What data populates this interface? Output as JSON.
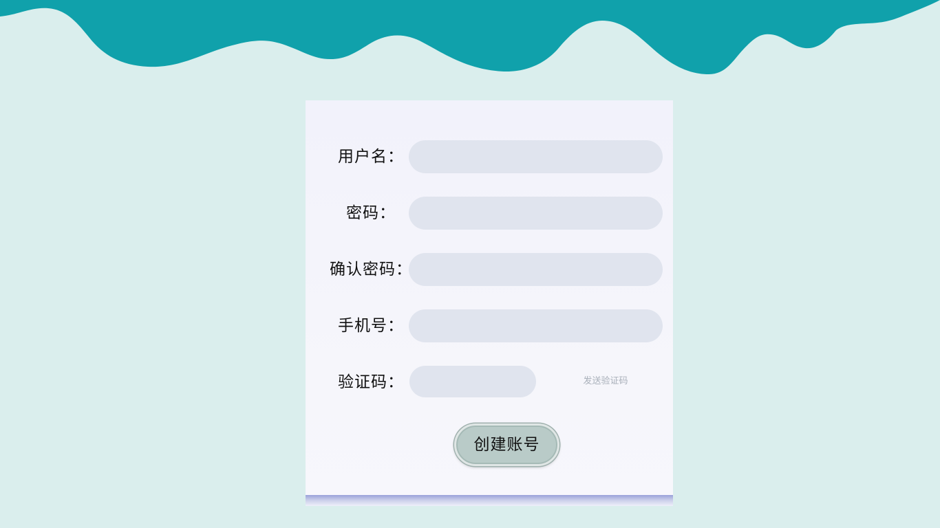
{
  "colors": {
    "background": "#daeeed",
    "wave": "#10a1ab",
    "card": "#f4f4fb",
    "input": "#e0e4ee",
    "button": "#b9cbc8",
    "send_code_text": "#a9b0ba"
  },
  "form": {
    "username_label": "用户名：",
    "password_label": "密码：",
    "confirm_password_label": "确认密码：",
    "phone_label": "手机号：",
    "verify_code_label": "验证码：",
    "send_code_label": "发送验证码",
    "create_button_label": "创建账号",
    "username_value": "",
    "password_value": "",
    "confirm_password_value": "",
    "phone_value": "",
    "verify_code_value": ""
  }
}
